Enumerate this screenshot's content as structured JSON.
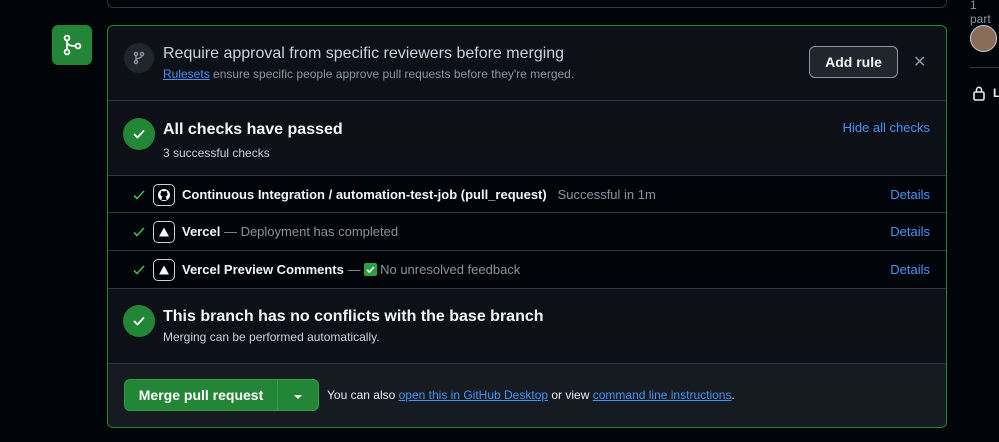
{
  "sidebar": {
    "participants_text": "1 part",
    "lock_label": "L"
  },
  "approval": {
    "title": "Require approval from specific reviewers before merging",
    "rulesets_link": "Rulesets",
    "subtitle_rest": " ensure specific people approve pull requests before they're merged.",
    "add_rule_label": "Add rule",
    "close_glyph": "✕"
  },
  "checks": {
    "title": "All checks have passed",
    "subtitle": "3 successful checks",
    "hide_link": "Hide all checks",
    "items": [
      {
        "name": "Continuous Integration / automation-test-job (pull_request)",
        "sep": "",
        "status": "Successful in 1m",
        "details": "Details",
        "icon": "github-icon"
      },
      {
        "name": "Vercel",
        "sep": " — ",
        "status": "Deployment has completed",
        "details": "Details",
        "icon": "vercel-icon"
      },
      {
        "name": "Vercel Preview Comments",
        "sep": " — ",
        "status": "No unresolved feedback",
        "details": "Details",
        "icon": "vercel-icon"
      }
    ]
  },
  "conflicts": {
    "title": "This branch has no conflicts with the base branch",
    "subtitle": "Merging can be performed automatically."
  },
  "merge": {
    "button_label": "Merge pull request",
    "note_prefix": "You can also ",
    "desktop_link": "open this in GitHub Desktop",
    "note_mid": " or view ",
    "cli_link": "command line instructions",
    "note_suffix": "."
  },
  "colors": {
    "accent_green": "#238636",
    "link_blue": "#4493f8",
    "background": "#010409"
  }
}
